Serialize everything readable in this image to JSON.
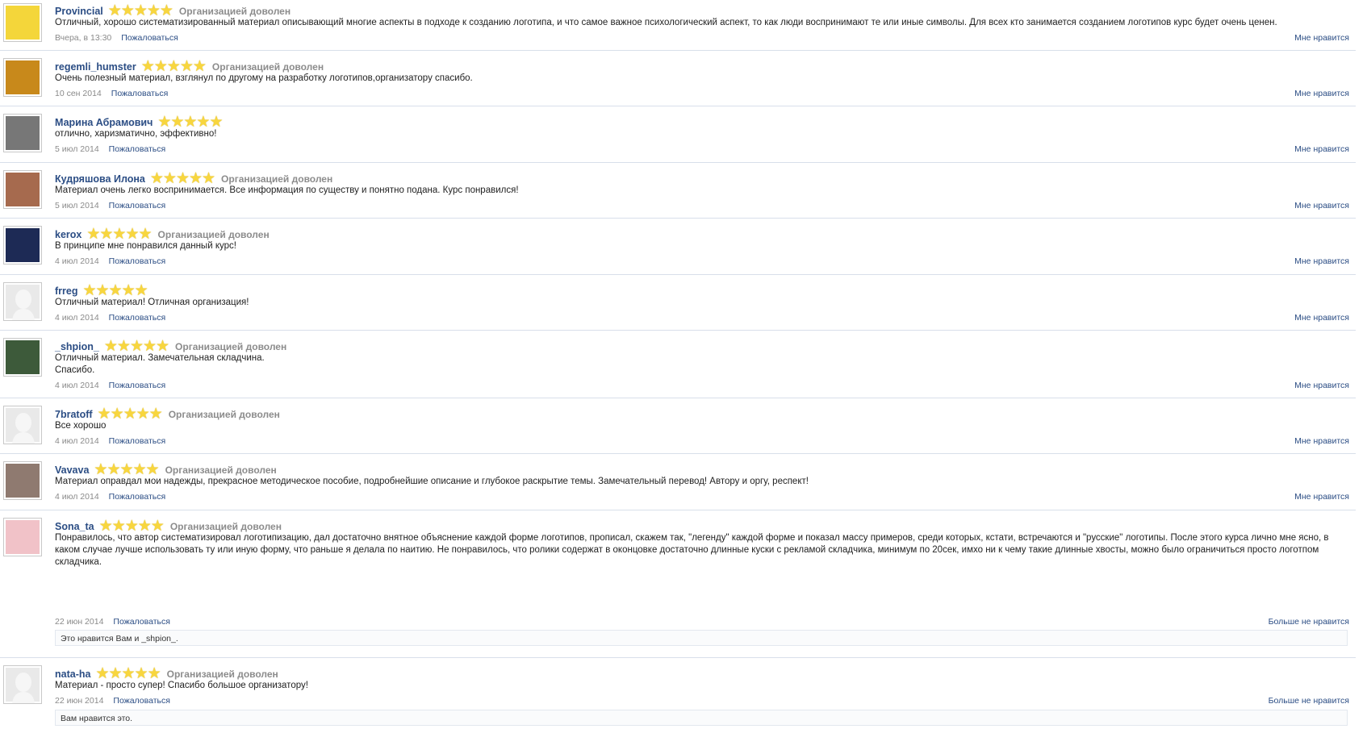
{
  "reviews": [
    {
      "username": "Provincial",
      "badge": "Организацией доволен",
      "text": "Отличный, хорошо систематизированный материал описывающий многие аспекты в подходе к созданию логотипа, и что самое важное психологический аспект, то как люди воспринимают те или иные символы. Для всех кто занимается созданием логотипов курс будет очень ценен.",
      "date": "Вчера, в 13:30",
      "report": "Пожаловаться",
      "like": "Мне нравится",
      "avatar_icon": "bart-simpson-avatar",
      "avatar_color": "#f4d63a"
    },
    {
      "username": "regemli_humster",
      "badge": "Организацией доволен",
      "text": "Очень полезный материал, взглянул по другому на разработку логотипов,организатору спасибо.",
      "date": "10 сен 2014",
      "report": "Пожаловаться",
      "like": "Мне нравится",
      "avatar_icon": "hamster-avatar",
      "avatar_color": "#c8891b"
    },
    {
      "username": "Марина Абрамович",
      "badge": "",
      "text": "отлично, харизматично, эффективно!",
      "date": "5 июл 2014",
      "report": "Пожаловаться",
      "like": "Мне нравится",
      "avatar_icon": "sketch-avatar",
      "avatar_color": "#777777"
    },
    {
      "username": "Кудряшова Илона",
      "badge": "Организацией доволен",
      "text": "Материал очень легко воспринимается. Все информация по существу и понятно подана. Курс понравился!",
      "date": "5 июл 2014",
      "report": "Пожаловаться",
      "like": "Мне нравится",
      "avatar_icon": "photo-avatar",
      "avatar_color": "#a66a4e"
    },
    {
      "username": "kerox",
      "badge": "Организацией доволен",
      "text": "В принципе мне понравился данный курс!",
      "date": "4 июл 2014",
      "report": "Пожаловаться",
      "like": "Мне нравится",
      "avatar_icon": "dark-avatar",
      "avatar_color": "#1d2a55"
    },
    {
      "username": "frreg",
      "badge": "",
      "text": "Отличный материал! Отличная организация!",
      "date": "4 июл 2014",
      "report": "Пожаловаться",
      "like": "Мне нравится",
      "avatar_icon": "default-user-avatar",
      "avatar_color": "#e2e2e2"
    },
    {
      "username": "_shpion_",
      "badge": "Организацией доволен",
      "text": "Отличный материал. Замечательная складчина.\nСпасибо.",
      "date": "4 июл 2014",
      "report": "Пожаловаться",
      "like": "Мне нравится",
      "avatar_icon": "hat-man-avatar",
      "avatar_color": "#3d5a3a"
    },
    {
      "username": "7bratoff",
      "badge": "Организацией доволен",
      "text": "Все хорошо",
      "date": "4 июл 2014",
      "report": "Пожаловаться",
      "like": "Мне нравится",
      "avatar_icon": "default-user-avatar",
      "avatar_color": "#e2e2e2"
    },
    {
      "username": "Vavava",
      "badge": "Организацией доволен",
      "text": "Материал оправдал мои надежды, прекрасное методическое пособие, подробнейшие описание и глубокое раскрытие темы. Замечательный перевод! Автору и оргу, респект!",
      "date": "4 июл 2014",
      "report": "Пожаловаться",
      "like": "Мне нравится",
      "avatar_icon": "ship-avatar",
      "avatar_color": "#8f7a70"
    },
    {
      "username": "Sona_ta",
      "badge": "Организацией доволен",
      "text": "Понравилось, что автор систематизировал логотипизацию, дал достаточно внятное объяснение каждой форме логотипов, прописал, скажем так, \"легенду\" каждой форме и показал массу примеров, среди которых, кстати, встречаются и \"русские\" логотипы. После этого курса лично мне ясно, в каком случае лучше использовать ту или иную форму, что раньше я делала по наитию. Не понравилось, что ролики содержат в оконцовке достаточно длинные куски с рекламой складчика, минимум по 20сек, имхо ни к чему такие длинные хвосты, можно было ограничиться просто логотпом складчика.",
      "date": "22 июн 2014",
      "report": "Пожаловаться",
      "like": "Больше не нравится",
      "likes_note": "Это нравится Вам и _shpion_.",
      "avatar_icon": "flowers-avatar",
      "avatar_color": "#f1c2c8"
    },
    {
      "username": "nata-ha",
      "badge": "Организацией доволен",
      "text": "Материал - просто супер! Спасибо большое организатору!",
      "date": "22 июн 2014",
      "report": "Пожаловаться",
      "like": "Больше не нравится",
      "likes_note": "Вам нравится это.",
      "avatar_icon": "default-user-avatar",
      "avatar_color": "#e2e2e2"
    }
  ],
  "stars_glyph": "★★★★★"
}
